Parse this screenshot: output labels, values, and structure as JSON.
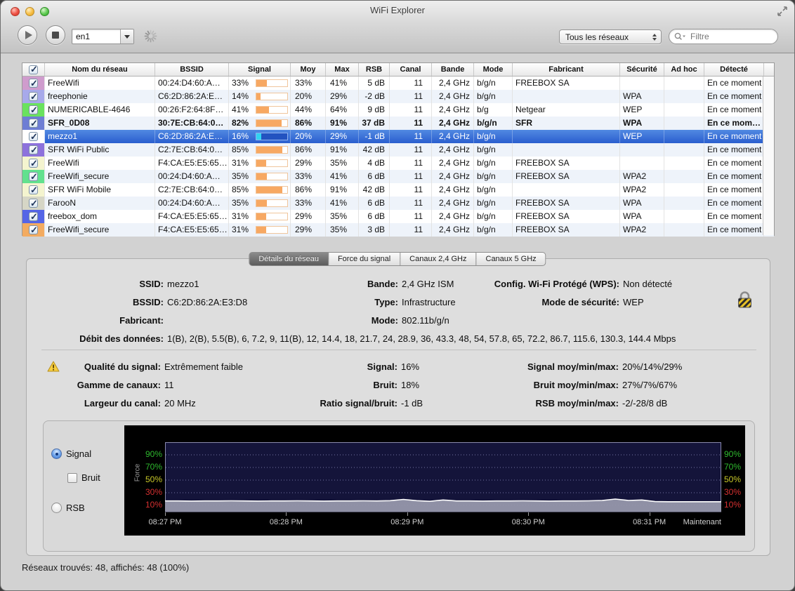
{
  "window": {
    "title": "WiFi Explorer",
    "status_bar": "Réseaux trouvés: 48, affichés: 48 (100%)"
  },
  "toolbar": {
    "interface_value": "en1",
    "scope_value": "Tous les réseaux",
    "filter_placeholder": "Filtre"
  },
  "table": {
    "headers": [
      "Nom du réseau",
      "BSSID",
      "Signal",
      "Moy",
      "Max",
      "RSB",
      "Canal",
      "Bande",
      "Mode",
      "Fabricant",
      "Sécurité",
      "Ad hoc",
      "Détecté"
    ],
    "rows": [
      {
        "color": "#cf9ccd",
        "name": "FreeWifi",
        "bssid": "00:24:D4:60:A…",
        "signal": "33%",
        "signal_pct": 33,
        "moy": "33%",
        "max": "41%",
        "rsb": "5 dB",
        "canal": "11",
        "bande": "2,4 GHz",
        "mode": "b/g/n",
        "fabricant": "FREEBOX SA",
        "securite": "",
        "adhoc": "",
        "detecte": "En ce moment",
        "bold": false,
        "selected": false
      },
      {
        "color": "#a7a9ea",
        "name": "freephonie",
        "bssid": "C6:2D:86:2A:E…",
        "signal": "14%",
        "signal_pct": 14,
        "moy": "20%",
        "max": "29%",
        "rsb": "-2 dB",
        "canal": "11",
        "bande": "2,4 GHz",
        "mode": "b/g/n",
        "fabricant": "",
        "securite": "WPA",
        "adhoc": "",
        "detecte": "En ce moment",
        "bold": false,
        "selected": false
      },
      {
        "color": "#6ae25e",
        "name": "NUMERICABLE-4646",
        "bssid": "00:26:F2:64:8F…",
        "signal": "41%",
        "signal_pct": 41,
        "moy": "44%",
        "max": "64%",
        "rsb": "9 dB",
        "canal": "11",
        "bande": "2,4 GHz",
        "mode": "b/g",
        "fabricant": "Netgear",
        "securite": "WEP",
        "adhoc": "",
        "detecte": "En ce moment",
        "bold": false,
        "selected": false
      },
      {
        "color": "#6e7ed4",
        "name": "SFR_0D08",
        "bssid": "30:7E:CB:64:0…",
        "signal": "82%",
        "signal_pct": 82,
        "moy": "86%",
        "max": "91%",
        "rsb": "37 dB",
        "canal": "11",
        "bande": "2,4 GHz",
        "mode": "b/g/n",
        "fabricant": "SFR",
        "securite": "WPA",
        "adhoc": "",
        "detecte": "En ce mom…",
        "bold": true,
        "selected": false
      },
      {
        "color": "#ffffff",
        "name": "mezzo1",
        "bssid": "C6:2D:86:2A:E…",
        "signal": "16%",
        "signal_pct": 16,
        "moy": "20%",
        "max": "29%",
        "rsb": "-1 dB",
        "canal": "11",
        "bande": "2,4 GHz",
        "mode": "b/g/n",
        "fabricant": "",
        "securite": "WEP",
        "adhoc": "",
        "detecte": "En ce moment",
        "bold": false,
        "selected": true
      },
      {
        "color": "#8d72dc",
        "name": "SFR WiFi Public",
        "bssid": "C2:7E:CB:64:0…",
        "signal": "85%",
        "signal_pct": 85,
        "moy": "86%",
        "max": "91%",
        "rsb": "42 dB",
        "canal": "11",
        "bande": "2,4 GHz",
        "mode": "b/g/n",
        "fabricant": "",
        "securite": "",
        "adhoc": "",
        "detecte": "En ce moment",
        "bold": false,
        "selected": false
      },
      {
        "color": "#f4f4cf",
        "name": "FreeWifi",
        "bssid": "F4:CA:E5:E5:65…",
        "signal": "31%",
        "signal_pct": 31,
        "moy": "29%",
        "max": "35%",
        "rsb": "4 dB",
        "canal": "11",
        "bande": "2,4 GHz",
        "mode": "b/g/n",
        "fabricant": "FREEBOX SA",
        "securite": "",
        "adhoc": "",
        "detecte": "En ce moment",
        "bold": false,
        "selected": false
      },
      {
        "color": "#62e18e",
        "name": "FreeWifi_secure",
        "bssid": "00:24:D4:60:A…",
        "signal": "35%",
        "signal_pct": 35,
        "moy": "33%",
        "max": "41%",
        "rsb": "6 dB",
        "canal": "11",
        "bande": "2,4 GHz",
        "mode": "b/g/n",
        "fabricant": "FREEBOX SA",
        "securite": "WPA2",
        "adhoc": "",
        "detecte": "En ce moment",
        "bold": false,
        "selected": false
      },
      {
        "color": "#f4f4cf",
        "name": "SFR WiFi Mobile",
        "bssid": "C2:7E:CB:64:0…",
        "signal": "85%",
        "signal_pct": 85,
        "moy": "86%",
        "max": "91%",
        "rsb": "42 dB",
        "canal": "11",
        "bande": "2,4 GHz",
        "mode": "b/g/n",
        "fabricant": "",
        "securite": "WPA2",
        "adhoc": "",
        "detecte": "En ce moment",
        "bold": false,
        "selected": false
      },
      {
        "color": "#d6d6c6",
        "name": "FarooN",
        "bssid": "00:24:D4:60:A…",
        "signal": "35%",
        "signal_pct": 35,
        "moy": "33%",
        "max": "41%",
        "rsb": "6 dB",
        "canal": "11",
        "bande": "2,4 GHz",
        "mode": "b/g/n",
        "fabricant": "FREEBOX SA",
        "securite": "WPA",
        "adhoc": "",
        "detecte": "En ce moment",
        "bold": false,
        "selected": false
      },
      {
        "color": "#5565e6",
        "name": "freebox_dom",
        "bssid": "F4:CA:E5:E5:65…",
        "signal": "31%",
        "signal_pct": 31,
        "moy": "29%",
        "max": "35%",
        "rsb": "6 dB",
        "canal": "11",
        "bande": "2,4 GHz",
        "mode": "b/g/n",
        "fabricant": "FREEBOX SA",
        "securite": "WPA",
        "adhoc": "",
        "detecte": "En ce moment",
        "bold": false,
        "selected": false
      },
      {
        "color": "#f3ab60",
        "name": "FreeWifi_secure",
        "bssid": "F4:CA:E5:E5:65…",
        "signal": "31%",
        "signal_pct": 31,
        "moy": "29%",
        "max": "35%",
        "rsb": "3 dB",
        "canal": "11",
        "bande": "2,4 GHz",
        "mode": "b/g/n",
        "fabricant": "FREEBOX SA",
        "securite": "WPA2",
        "adhoc": "",
        "detecte": "En ce moment",
        "bold": false,
        "selected": false
      }
    ]
  },
  "tabs": {
    "items": [
      "Détails du réseau",
      "Force du signal",
      "Canaux 2,4 GHz",
      "Canaux 5 GHz"
    ],
    "active_index": 0
  },
  "details": {
    "col1": [
      {
        "label": "SSID:",
        "value": "mezzo1"
      },
      {
        "label": "BSSID:",
        "value": "C6:2D:86:2A:E3:D8"
      },
      {
        "label": "Fabricant:",
        "value": ""
      }
    ],
    "col2": [
      {
        "label": "Bande:",
        "value": "2,4 GHz ISM"
      },
      {
        "label": "Type:",
        "value": "Infrastructure"
      },
      {
        "label": "Mode:",
        "value": "802.11b/g/n"
      }
    ],
    "col3": [
      {
        "label": "Config. Wi-Fi Protégé (WPS):",
        "value": "Non détecté"
      },
      {
        "label": "Mode de sécurité:",
        "value": "WEP"
      }
    ],
    "debit": {
      "label": "Débit des données:",
      "value": "1(B), 2(B), 5.5(B), 6, 7.2, 9, 11(B), 12, 14.4, 18, 21.7, 24, 28.9, 36, 43.3, 48, 54, 57.8, 65, 72.2, 86.7, 115.6, 130.3, 144.4 Mbps"
    }
  },
  "quality": {
    "col1": [
      {
        "label": "Qualité du signal:",
        "value": "Extrêmement faible"
      },
      {
        "label": "Gamme de canaux:",
        "value": "11"
      },
      {
        "label": "Largeur du canal:",
        "value": "20 MHz"
      }
    ],
    "col2": [
      {
        "label": "Signal:",
        "value": "16%"
      },
      {
        "label": "Bruit:",
        "value": "18%"
      },
      {
        "label": "Ratio signal/bruit:",
        "value": "-1 dB"
      }
    ],
    "col3": [
      {
        "label": "Signal moy/min/max:",
        "value": "20%/14%/29%"
      },
      {
        "label": "Bruit moy/min/max:",
        "value": "27%/7%/67%"
      },
      {
        "label": "RSB moy/min/max:",
        "value": "-2/-28/8 dB"
      }
    ]
  },
  "chart_controls": {
    "signal_label": "Signal",
    "bruit_label": "Bruit",
    "rsb_label": "RSB",
    "signal_selected": true,
    "bruit_checked": false,
    "rsb_selected": false
  },
  "chart_data": {
    "type": "line",
    "ylabel": "Force",
    "x_labels": [
      "08:27 PM",
      "08:28 PM",
      "08:29 PM",
      "08:30 PM",
      "08:31 PM",
      "Maintenant"
    ],
    "y_ticks": [
      90,
      70,
      50,
      30,
      10
    ],
    "y_tick_colors": {
      "90": "#2eb82e",
      "70": "#2eb82e",
      "50": "#c9c929",
      "30": "#d63030",
      "10": "#d63030"
    },
    "ylim": [
      0,
      110
    ],
    "series": [
      {
        "name": "Signal",
        "values": [
          17,
          17,
          16.8,
          17,
          17,
          17.2,
          17,
          16.8,
          17,
          17,
          17.2,
          17,
          16.8,
          17,
          17,
          17.2,
          17,
          17.5,
          19.5,
          17.5,
          16.5,
          18.5,
          17,
          17,
          16.8,
          17,
          17,
          17.2,
          17,
          16.8,
          17,
          17,
          17.2,
          17.8,
          20,
          17.8,
          18.5,
          16,
          15.8,
          15.8,
          15.8,
          15.8,
          15.8
        ]
      }
    ],
    "colors": {
      "plot_bg": "#14143a",
      "grid": "#8080b0",
      "line": "#ffffff",
      "fill": "#9697ab"
    }
  }
}
